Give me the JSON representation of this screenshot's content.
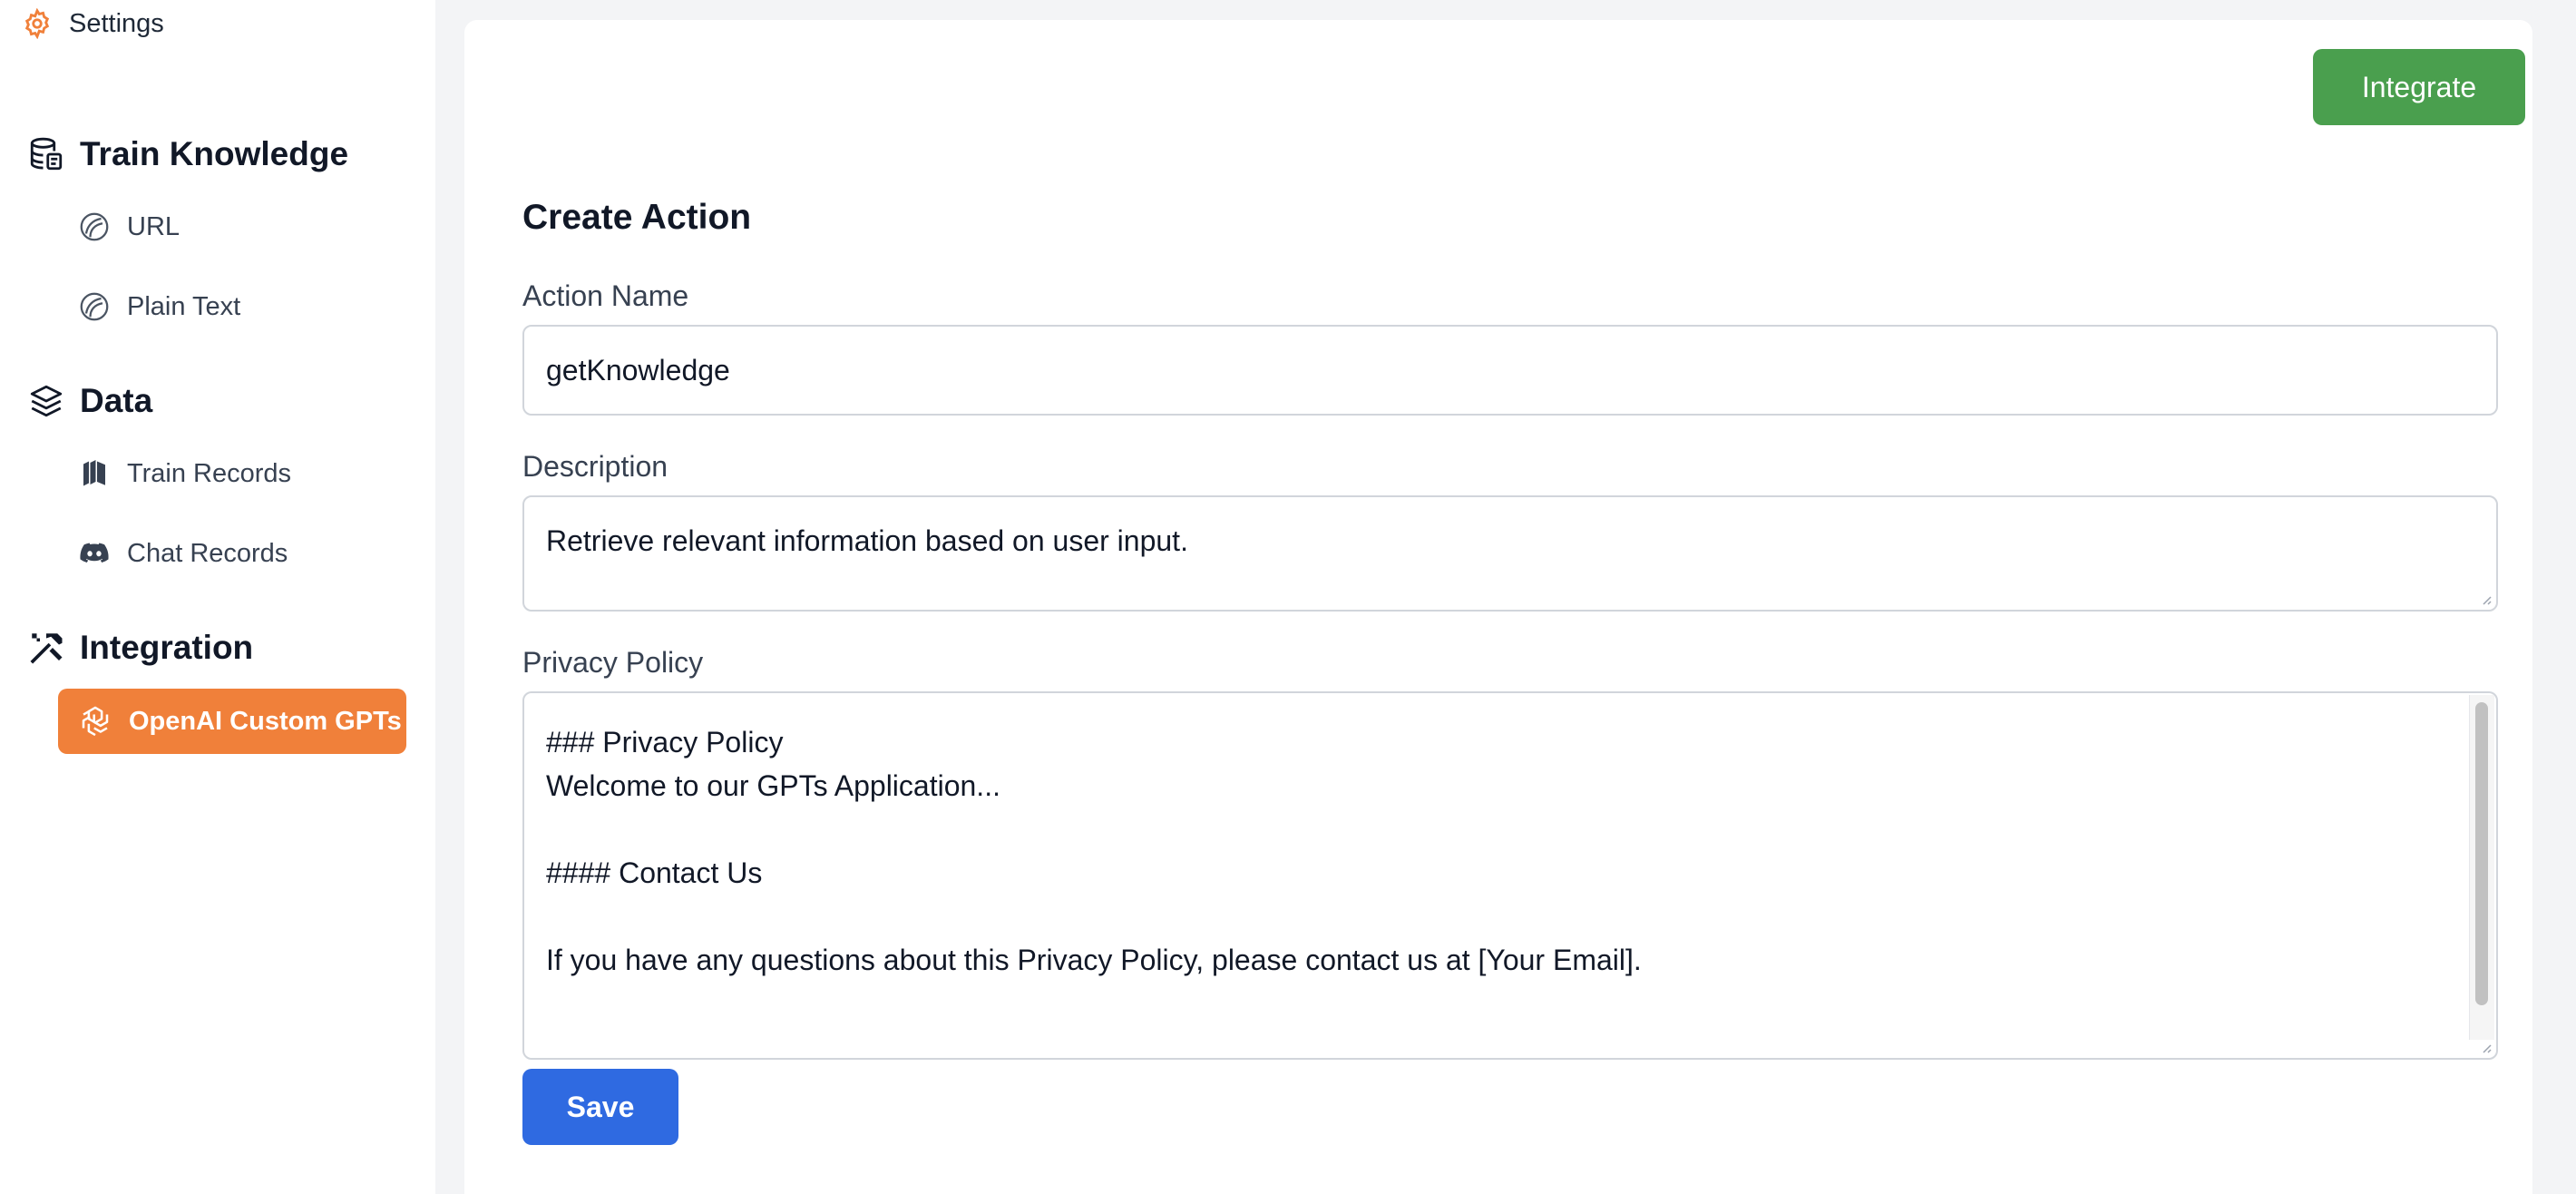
{
  "sidebar": {
    "settings": {
      "label": "Settings",
      "icon": "gear-icon"
    },
    "sections": [
      {
        "title": "Train Knowledge",
        "icon": "database-icon",
        "items": [
          {
            "label": "URL",
            "icon": "globe-icon"
          },
          {
            "label": "Plain Text",
            "icon": "globe-icon"
          }
        ]
      },
      {
        "title": "Data",
        "icon": "layers-icon",
        "items": [
          {
            "label": "Train Records",
            "icon": "files-icon"
          },
          {
            "label": "Chat Records",
            "icon": "discord-icon"
          }
        ]
      },
      {
        "title": "Integration",
        "icon": "tools-icon",
        "items": [
          {
            "label": "OpenAI Custom GPTs",
            "icon": "openai-icon",
            "active": true
          }
        ]
      }
    ]
  },
  "main": {
    "integrate_label": "Integrate",
    "form_title": "Create Action",
    "action_name": {
      "label": "Action Name",
      "value": "getKnowledge"
    },
    "description": {
      "label": "Description",
      "value": "Retrieve relevant information based on user input."
    },
    "privacy_policy": {
      "label": "Privacy Policy",
      "lines": [
        "### Privacy Policy",
        "Welcome to our GPTs Application...",
        "",
        "#### Contact Us",
        "",
        "If you have any questions about this Privacy Policy, please contact us at [Your Email]."
      ]
    },
    "save_label": "Save"
  },
  "colors": {
    "accent_orange": "#f0803a",
    "integrate_green": "#4a9f4e",
    "save_blue": "#2f6ae1",
    "page_bg": "#f3f4f6"
  }
}
